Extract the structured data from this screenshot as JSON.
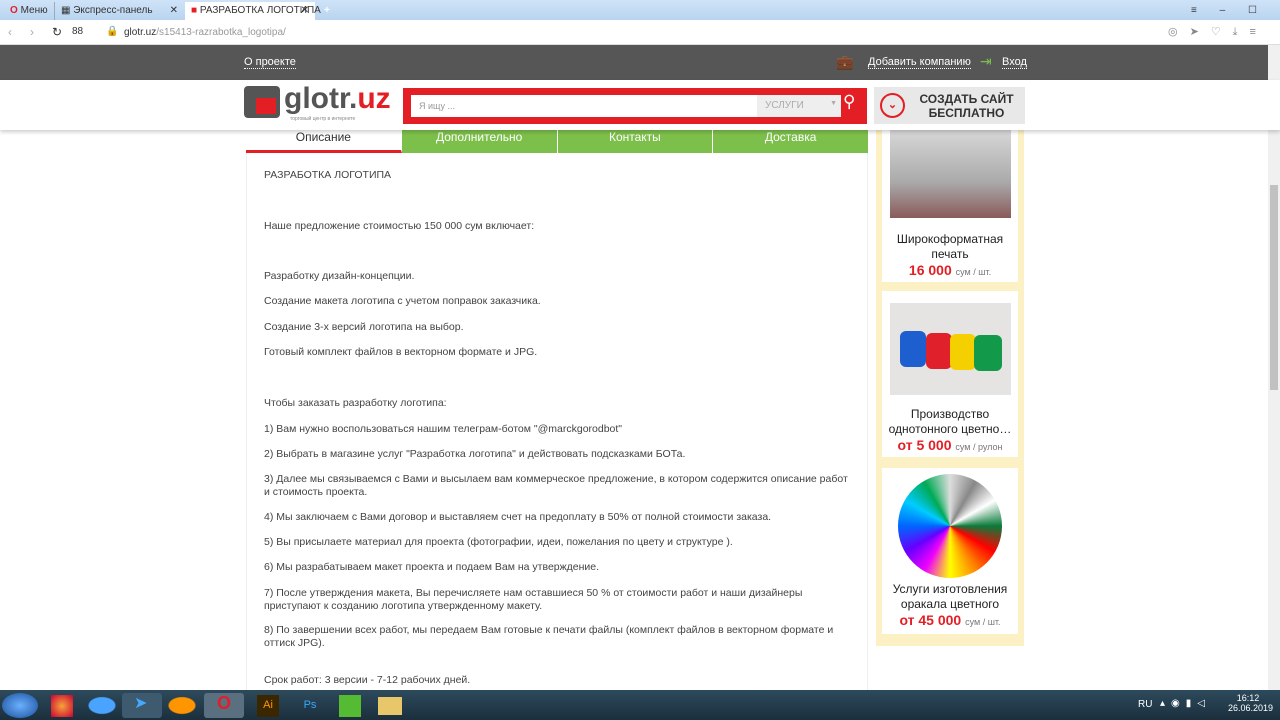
{
  "browser": {
    "tabs": [
      {
        "label": "Меню"
      },
      {
        "label": "Экспресс-панель"
      },
      {
        "label": "РАЗРАБОТКА ЛОГОТИПА"
      }
    ],
    "url_domain": "glotr.uz",
    "url_path": "/s15413-razrabotka_logotipa/"
  },
  "topbar": {
    "about": "О проекте",
    "add_company": "Добавить компанию",
    "login": "Вход"
  },
  "header": {
    "logo": "glotr.uz",
    "logo_tagline": "торговый центр в интернете",
    "search_placeholder": "Я ищу ...",
    "search_category": "УСЛУГИ",
    "create_site": "СОЗДАТЬ САЙТ БЕСПЛАТНО"
  },
  "page_tabs": [
    "Описание",
    "Дополнительно",
    "Контакты",
    "Доставка"
  ],
  "content": [
    "РАЗРАБОТКА ЛОГОТИПА",
    "Наше предложение стоимостью 150 000 сум включает:",
    "Разработку дизайн-концепции.",
    "Создание макета логотипа с учетом поправок заказчика.",
    "Создание 3-х версий логотипа на выбор.",
    "Готовый комплект файлов в векторном формате и JPG.",
    "Чтобы заказать разработку логотипа:",
    "1) Вам нужно воспользоваться нашим телеграм-ботом \"@marckgorodbot\"",
    "2) Выбрать в магазине услуг \"Разработка логотипа\" и действовать подсказками БОТа.",
    "3) Далее мы связываемся с Вами и высылаем вам коммерческое предложение, в котором содержится описание работ и стоимость проекта.",
    "4) Мы заключаем с Вами договор и выставляем счет на предоплату в 50% от полной стоимости заказа.",
    "5) Вы присылаете материал для проекта (фотографии, идеи, пожелания по цвету и структуре ).",
    "6) Мы разрабатываем макет проекта и подаем Вам на утверждение.",
    "7) После утверждения макета, Вы перечисляете нам оставшиеся 50 % от стоимости работ и наши дизайнеры приступают к созданию логотипа утвержденному макету.",
    "8) По завершении всех работ, мы передаем Вам готовые к печати файлы (комплект файлов в векторном формате и оттиск JPG).",
    "Срок работ: 3 версии - 7-12 рабочих дней."
  ],
  "sidebar": [
    {
      "title": "Широкоформатная печать",
      "price": "16 000",
      "unit": "сум / шт."
    },
    {
      "title": "Производство однотонного цветно…",
      "price": "от 5 000",
      "unit": "сум / рулон"
    },
    {
      "title": "Услуги изготовления оракала цветного",
      "price": "от 45 000",
      "unit": "сум / шт."
    }
  ],
  "tray": {
    "lang": "RU",
    "time": "16:12",
    "date": "26.06.2019"
  }
}
